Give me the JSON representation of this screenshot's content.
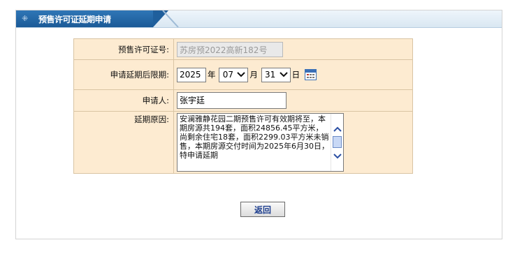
{
  "header": {
    "title": "预售许可证延期申请",
    "deco_icon": "grid-dots-icon"
  },
  "form": {
    "permit_label": "预售许可证号:",
    "permit_value": "苏房预2022高新182号",
    "extend_label": "申请延期后限期:",
    "year": "2025",
    "year_unit": "年",
    "month": "07",
    "month_unit": "月",
    "day": "31",
    "day_unit": "日",
    "applicant_label": "申请人:",
    "applicant_value": "张宇廷",
    "reason_label": "延期原因:",
    "reason_text": "安澜雅静花园二期预售许可有效期将至，本期房源共194套，面积24856.45平方米，尚剩余住宅18套，面积2299.03平方米未销售，本期房源交付时间为2025年6月30日，特申请延期"
  },
  "buttons": {
    "back_label": "返回"
  },
  "colors": {
    "header_blue": "#1f5f9c",
    "form_bg": "#fdebd1",
    "form_border": "#c9a77a",
    "button_text": "#1e3f8f"
  }
}
